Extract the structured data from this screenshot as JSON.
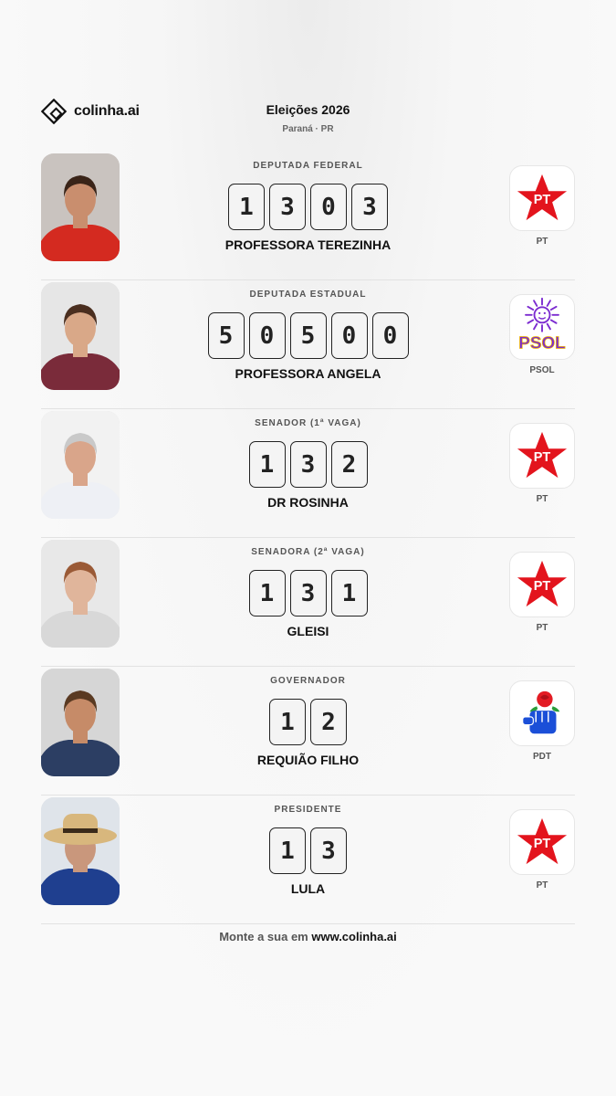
{
  "header": {
    "brand": "colinha.ai",
    "title": "Eleições 2026",
    "subtitle": "Paraná · PR"
  },
  "candidates": [
    {
      "role": "DEPUTADA FEDERAL",
      "number": [
        "1",
        "3",
        "0",
        "3"
      ],
      "name": "PROFESSORA TEREZINHA",
      "party": "PT",
      "party_icon": "pt-star-icon",
      "photo_colors": {
        "bg": "#c9c3bf",
        "shirt": "#d42a20",
        "skin": "#c98e6e",
        "hair": "#3a2418"
      }
    },
    {
      "role": "DEPUTADA ESTADUAL",
      "number": [
        "5",
        "0",
        "5",
        "0",
        "0"
      ],
      "name": "PROFESSORA ANGELA",
      "party": "PSOL",
      "party_icon": "psol-sun-icon",
      "photo_colors": {
        "bg": "#e6e6e6",
        "shirt": "#7a2b3a",
        "skin": "#d9a888",
        "hair": "#4a2e1f"
      }
    },
    {
      "role": "SENADOR (1ª VAGA)",
      "number": [
        "1",
        "3",
        "2"
      ],
      "name": "DR ROSINHA",
      "party": "PT",
      "party_icon": "pt-star-icon",
      "photo_colors": {
        "bg": "#f2f2f2",
        "shirt": "#eef0f5",
        "skin": "#d9a58a",
        "hair": "#c9c9c9"
      }
    },
    {
      "role": "SENADORA (2ª VAGA)",
      "number": [
        "1",
        "3",
        "1"
      ],
      "name": "GLEISI",
      "party": "PT",
      "party_icon": "pt-star-icon",
      "photo_colors": {
        "bg": "#e8e8e8",
        "shirt": "#d8d8d8",
        "skin": "#e0b59b",
        "hair": "#9a5a36"
      }
    },
    {
      "role": "GOVERNADOR",
      "number": [
        "1",
        "2"
      ],
      "name": "REQUIÃO FILHO",
      "party": "PDT",
      "party_icon": "pdt-rose-fist-icon",
      "photo_colors": {
        "bg": "#d6d6d6",
        "shirt": "#2c3e63",
        "skin": "#c68b68",
        "hair": "#5a3a22"
      }
    },
    {
      "role": "PRESIDENTE",
      "number": [
        "1",
        "3"
      ],
      "name": "LULA",
      "party": "PT",
      "party_icon": "pt-star-icon",
      "photo_colors": {
        "bg": "#dfe4ea",
        "shirt": "#1f3f8f",
        "skin": "#c9977c",
        "hair": "#e8e8e8",
        "hat": "#d8b77d"
      }
    }
  ],
  "footer": {
    "prefix": "Monte a sua em",
    "link": "www.colinha.ai"
  },
  "colors": {
    "pt_red": "#e3141d",
    "psol_purple": "#7b2bd0",
    "psol_yellow": "#f2b800",
    "pdt_blue": "#1b4fd8",
    "pdt_red": "#e31b23"
  }
}
